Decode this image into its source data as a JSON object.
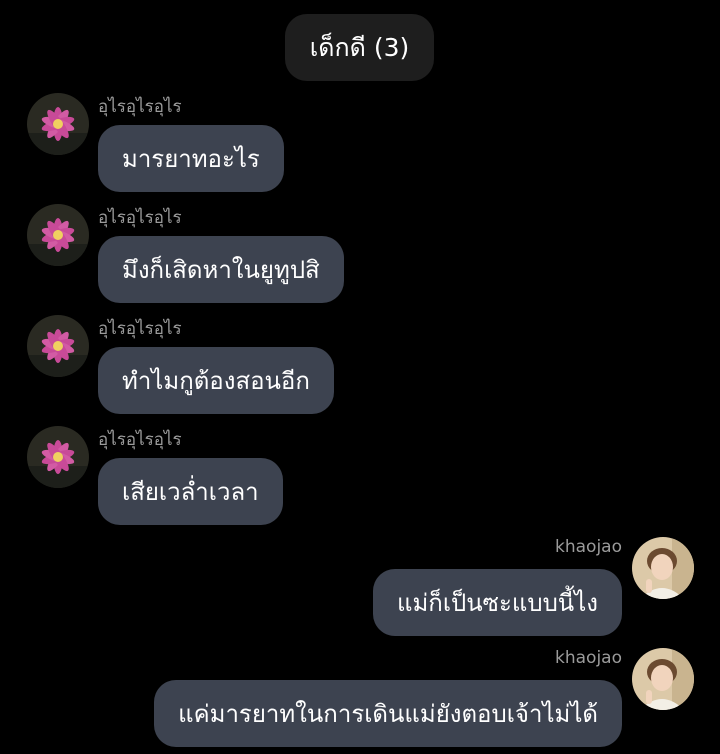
{
  "chat": {
    "title": "เด็กดี (3)"
  },
  "messages": [
    {
      "direction": "in",
      "sender": "อุไรอุไรอุไร",
      "text": "มารยาทอะไร",
      "avatar": "water-lily-avatar"
    },
    {
      "direction": "in",
      "sender": "อุไรอุไรอุไร",
      "text": "มึงก็เสิดหาในยูทูปสิ",
      "avatar": "water-lily-avatar"
    },
    {
      "direction": "in",
      "sender": "อุไรอุไรอุไร",
      "text": "ทำไมกูต้องสอนอีก",
      "avatar": "water-lily-avatar"
    },
    {
      "direction": "in",
      "sender": "อุไรอุไรอุไร",
      "text": "เสียเวล่ำเวลา",
      "avatar": "water-lily-avatar"
    },
    {
      "direction": "out",
      "sender": "khaojao",
      "text": "แม่ก็เป็นซะแบบนี้ไง",
      "avatar": "person-avatar"
    },
    {
      "direction": "out",
      "sender": "khaojao",
      "text": "แค่มารยาทในการเดินแม่ยังตอบเจ้าไม่ได้",
      "avatar": "person-avatar"
    }
  ],
  "colors": {
    "background": "#000000",
    "header_pill": "#1e1e1e",
    "bubble": "#3d4350",
    "sender_text": "#9b9b9b"
  }
}
